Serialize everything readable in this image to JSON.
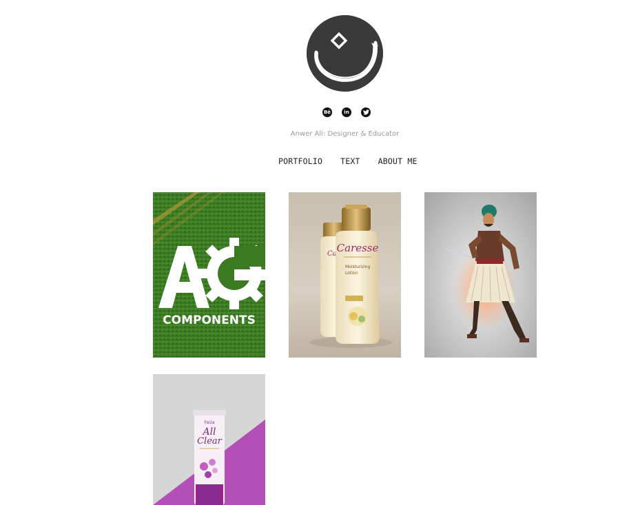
{
  "site": {
    "tagline": "Anwer Ali: Designer & Educator"
  },
  "social": [
    {
      "icon": "behance-icon",
      "glyph": "Bē"
    },
    {
      "icon": "linkedin-icon",
      "glyph": "in"
    },
    {
      "icon": "twitter-icon",
      "glyph": "🐦"
    }
  ],
  "nav": {
    "items": [
      "PORTFOLIO",
      "TEXT",
      "ABOUT ME"
    ]
  },
  "portfolio": {
    "projects": [
      {
        "name": "ag-components",
        "logo_text_1": "AG",
        "logo_text_2": "COMPONENTS"
      },
      {
        "name": "caresse-lotion",
        "brand": "Caresse",
        "label": "Moisturizing Lotion"
      },
      {
        "name": "warrior-illustration"
      },
      {
        "name": "all-clear",
        "brand_line_1": "All",
        "brand_line_2": "Clear"
      }
    ]
  },
  "colors": {
    "grass": "#3c7a24",
    "purple": "#b44fb7",
    "avatar_bg": "#3a3a3a"
  }
}
